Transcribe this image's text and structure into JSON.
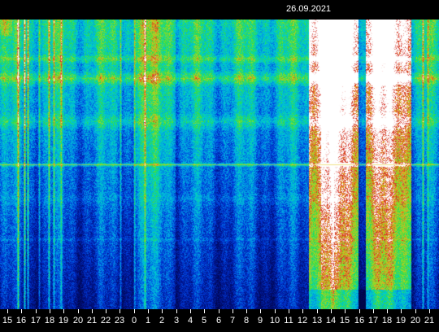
{
  "date": "26.09.2021",
  "hour_labels": [
    "15",
    "16",
    "17",
    "18",
    "19",
    "20",
    "21",
    "22",
    "23",
    "0",
    "1",
    "2",
    "3",
    "4",
    "5",
    "6",
    "7",
    "8",
    "9",
    "10",
    "11",
    "12",
    "13",
    "14",
    "15",
    "16",
    "17",
    "18",
    "19",
    "20",
    "21"
  ],
  "colors": {
    "low": "#000a6e",
    "mid_low": "#0040e0",
    "mid": "#00c8e6",
    "mid_high": "#32e650",
    "high": "#e6c828",
    "peak": "#c81e1e",
    "saturated": "#ffffff"
  }
}
